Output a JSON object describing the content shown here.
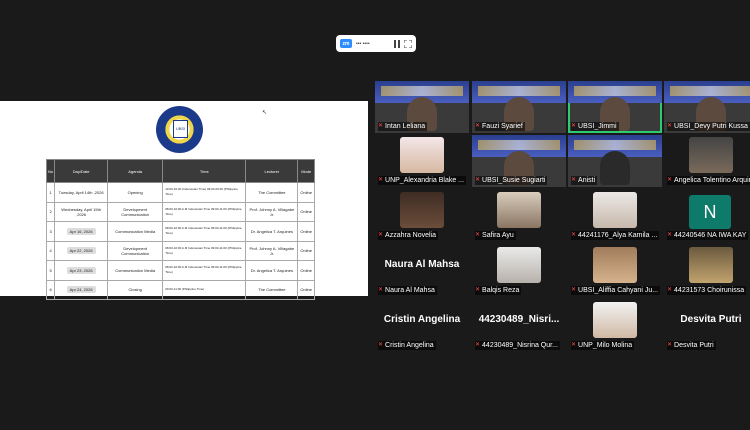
{
  "toolbar": {
    "meeting_label": "••• ••••",
    "pause_icon": "pause-icon",
    "expand_icon": "expand-icon"
  },
  "slide": {
    "headers": [
      "No",
      "Day/Date",
      "Agenda",
      "Time",
      "Lecturer",
      "Mode"
    ],
    "rows": [
      {
        "no": "1",
        "date": "Tuesday, April 14th ,2026",
        "agenda": "Opening",
        "time": "10:00-10:30 (Indonesian Time)  09:00-09:30 (Philippine Time)",
        "lecturer": "The Committee",
        "mode": "Online"
      },
      {
        "no": "2",
        "date": "Wednesday, April 15th ,2026",
        "agenda": "Development Communication",
        "time": "08:00-10:00 A.M Indonesian Time  09:00-11:00 (Philippine Time)",
        "lecturer": "Prof. Johnny A. Villagabe Jr.",
        "mode": "Online"
      },
      {
        "no": "3",
        "date": "Apr 16, 2026",
        "agenda": "Communication Media",
        "time": "08:00-10:00 A.M Indonesian Time  09:00-11:00 (Philippine Time)",
        "lecturer": "Dr. Angelica T. Arquines",
        "mode": "Online"
      },
      {
        "no": "4",
        "date": "Apr 22, 2026",
        "agenda": "Development Communication",
        "time": "08:00-10:00 A.M Indonesian Time  09:00-11:00 (Philippine Time)",
        "lecturer": "Prof. Johnny A. Villagabe Jr.",
        "mode": "Online"
      },
      {
        "no": "5",
        "date": "Apr 23, 2026",
        "agenda": "Communication Media",
        "time": "08:00-10:00 A.M Indonesian Time  09:00-11:00 (Philippine Time)",
        "lecturer": "Dr. Angelica T. Arquines",
        "mode": "Online"
      },
      {
        "no": "6",
        "date": "Apr 24, 2026",
        "agenda": "Closing",
        "time": "09:00-11:00 (Philippine Time)",
        "lecturer": "The Committee",
        "mode": "Online"
      }
    ]
  },
  "participants": [
    "Intan Leliana",
    "Fauzi Syarief",
    "UBSI_Jimmi",
    "UBSI_Devy Putri Kussa",
    "UNP_Alexandria Blake ...",
    "UBSI_Susie Sugiarti",
    "Anisti",
    "Angelica Tolentino Arquin",
    "Azzahra Novelia",
    "Safira Ayu",
    "44241176_Alya Kamila ...",
    "44240546 NA IWA KAY",
    "Naura Al Mahsa",
    "Balqis Reza",
    "UBSI_Aliffia Cahyani Ju...",
    "44231573 Choirunissa",
    "Cristin Angelina",
    "44230489_Nisrina Qur...",
    "UNP_Milo Molina",
    "Desvita Putri"
  ],
  "big_names": {
    "naura": "Naura Al Mahsa",
    "cristin": "Cristin Angelina",
    "nisrina": "44230489_Nisri...",
    "desvita": "Desvita Putri"
  },
  "initial_n": "N",
  "colors": {
    "active_border": "#2ecc71",
    "muted_mic": "#ff4a4a",
    "background": "#1a1a1a"
  }
}
